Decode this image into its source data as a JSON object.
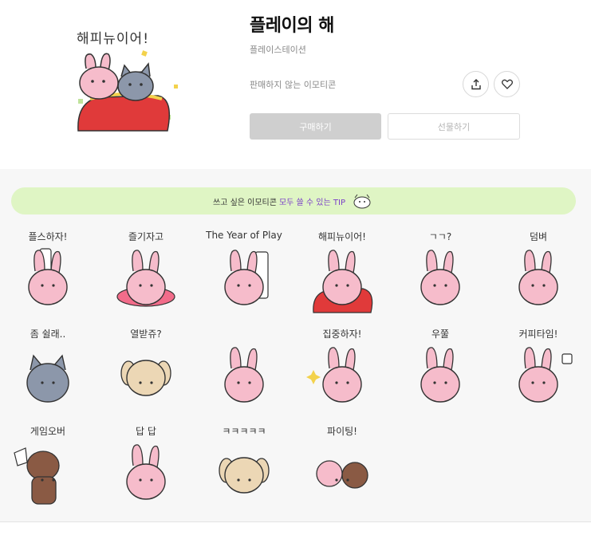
{
  "hero": {
    "caption": "해피뉴이어!",
    "title": "플레이의 해",
    "author": "플레이스테이션",
    "status": "판매하지 않는 이모티콘",
    "buy_label": "구매하기",
    "gift_label": "선물하기",
    "share_icon": "share-icon",
    "like_icon": "heart-icon"
  },
  "tip": {
    "prefix": "쓰고 싶은 이모티콘",
    "highlight": "모두 쓸 수 있는 TIP"
  },
  "stickers": [
    {
      "caption": "플스하자!",
      "char": "bunny",
      "prop": "console"
    },
    {
      "caption": "즐기자고",
      "char": "bunny",
      "prop": "float"
    },
    {
      "caption": "The Year of Play",
      "char": "bunny",
      "prop": "tv"
    },
    {
      "caption": "해피뉴이어!",
      "char": "bunny",
      "prop": "bag"
    },
    {
      "caption": "ㄱㄱ?",
      "char": "bunny",
      "prop": "trio"
    },
    {
      "caption": "덤벼",
      "char": "bunny",
      "prop": "headband"
    },
    {
      "caption": "좀 쉴래..",
      "char": "cat",
      "prop": ""
    },
    {
      "caption": "열받쥬?",
      "char": "dog",
      "prop": ""
    },
    {
      "caption": "",
      "char": "bunny",
      "prop": "hand"
    },
    {
      "caption": "집중하자!",
      "char": "bunny",
      "prop": "sparkle"
    },
    {
      "caption": "우쭐",
      "char": "bunny",
      "prop": ""
    },
    {
      "caption": "커피타임!",
      "char": "bunny",
      "prop": "cup"
    },
    {
      "caption": "게임오버",
      "char": "brown",
      "prop": "flag"
    },
    {
      "caption": "답 답",
      "char": "bunny",
      "prop": ""
    },
    {
      "caption": "ㅋㅋㅋㅋㅋ",
      "char": "dog",
      "prop": ""
    },
    {
      "caption": "파이팅!",
      "char": "duo",
      "prop": ""
    }
  ]
}
